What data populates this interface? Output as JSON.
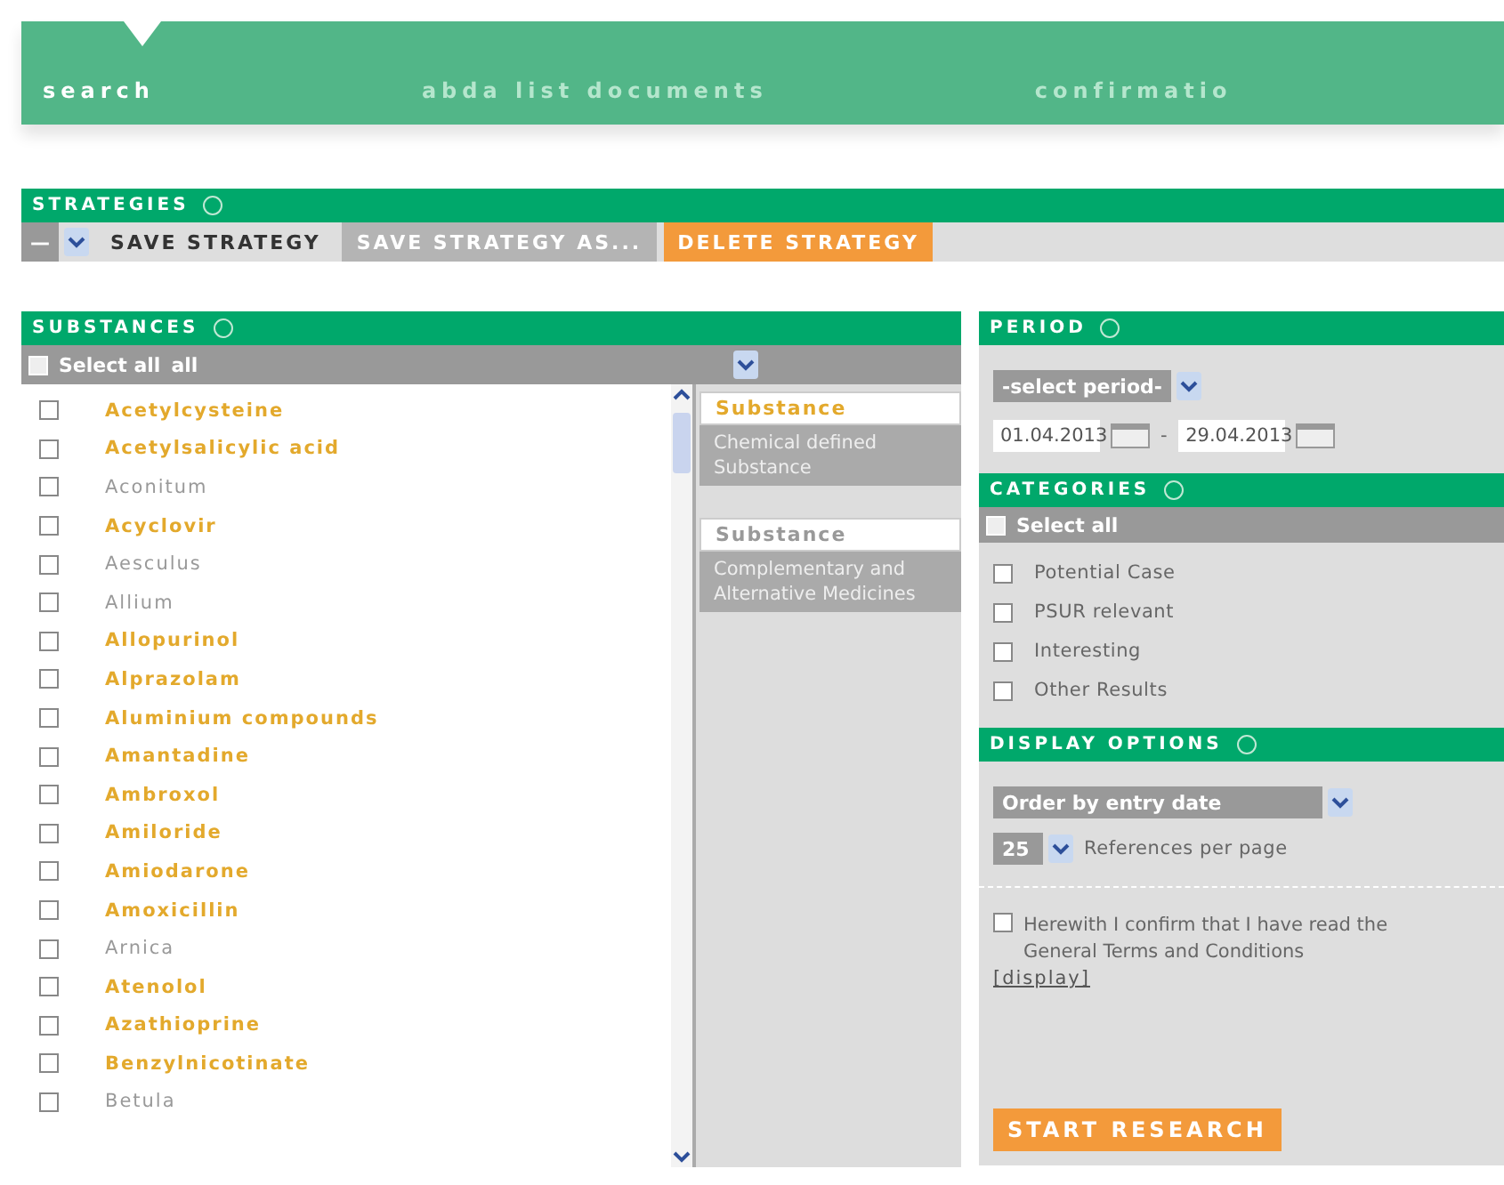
{
  "nav_tabs": [
    {
      "label": "search",
      "selected": true
    },
    {
      "label": "abda list documents",
      "selected": false
    },
    {
      "label": "confirmatio",
      "selected": false
    }
  ],
  "strategies": {
    "title": "STRATEGIES",
    "select_value": "—",
    "buttons": [
      {
        "label": "SAVE STRATEGY",
        "kind": "plain"
      },
      {
        "label": "SAVE STRATEGY AS...",
        "kind": "gray"
      },
      {
        "label": "DELETE STRATEGY",
        "kind": "orange"
      }
    ]
  },
  "substances": {
    "title": "SUBSTANCES",
    "select_all": {
      "label": "Select all",
      "checked": false
    },
    "filter_value": "all",
    "items": [
      {
        "name": "Acetylcysteine",
        "kind": "chemical",
        "checked": false
      },
      {
        "name": "Acetylsalicylic acid",
        "kind": "chemical",
        "checked": false
      },
      {
        "name": "Aconitum",
        "kind": "herbal",
        "checked": false
      },
      {
        "name": "Acyclovir",
        "kind": "chemical",
        "checked": false
      },
      {
        "name": "Aesculus",
        "kind": "herbal",
        "checked": false
      },
      {
        "name": "Allium",
        "kind": "herbal",
        "checked": false
      },
      {
        "name": "Allopurinol",
        "kind": "chemical",
        "checked": false
      },
      {
        "name": "Alprazolam",
        "kind": "chemical",
        "checked": false
      },
      {
        "name": "Aluminium compounds",
        "kind": "chemical",
        "checked": false
      },
      {
        "name": "Amantadine",
        "kind": "chemical",
        "checked": false
      },
      {
        "name": "Ambroxol",
        "kind": "chemical",
        "checked": false
      },
      {
        "name": "Amiloride",
        "kind": "chemical",
        "checked": false
      },
      {
        "name": "Amiodarone",
        "kind": "chemical",
        "checked": false
      },
      {
        "name": "Amoxicillin",
        "kind": "chemical",
        "checked": false
      },
      {
        "name": "Arnica",
        "kind": "herbal",
        "checked": false
      },
      {
        "name": "Atenolol",
        "kind": "chemical",
        "checked": false
      },
      {
        "name": "Azathioprine",
        "kind": "chemical",
        "checked": false
      },
      {
        "name": "Benzylnicotinate",
        "kind": "chemical",
        "checked": false
      },
      {
        "name": "Betula",
        "kind": "herbal",
        "checked": false
      }
    ],
    "legend": [
      {
        "label": "Substance",
        "selected": true,
        "description": "Chemical defined Substance"
      },
      {
        "label": "Substance",
        "selected": false,
        "description": "Complementary and Alternative Medicines"
      }
    ]
  },
  "period": {
    "title": "PERIOD",
    "select_value": "-select period-",
    "from": "01.04.2013",
    "separator": "-",
    "to": "29.04.2013"
  },
  "categories": {
    "title": "CATEGORIES",
    "select_all": {
      "label": "Select all",
      "checked": false
    },
    "items": [
      {
        "label": "Potential Case",
        "checked": false
      },
      {
        "label": "PSUR relevant",
        "checked": false
      },
      {
        "label": "Interesting",
        "checked": false
      },
      {
        "label": "Other Results",
        "checked": false
      }
    ]
  },
  "display_options": {
    "title": "DISPLAY OPTIONS",
    "order_value": "Order by entry date",
    "per_page_value": "25",
    "per_page_label": "References per page",
    "confirm": {
      "label": "Herewith I confirm that I have read the General Terms and Conditions",
      "checked": false
    },
    "link": "[display]"
  },
  "start_button": "START RESEARCH"
}
